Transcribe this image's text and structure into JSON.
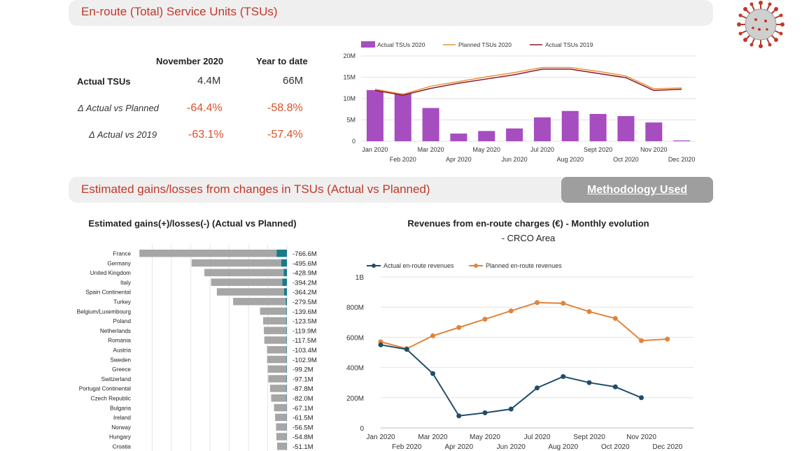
{
  "header1": {
    "title": "En-route (Total) Service Units (TSUs)"
  },
  "header2": {
    "title": "Estimated gains/losses from changes in TSUs (Actual vs Planned)",
    "button": "Methodology Used"
  },
  "kpi": {
    "col1": "November 2020",
    "col2": "Year to date",
    "rows": [
      {
        "label": "Actual TSUs",
        "v1": "4.4M",
        "v2": "66M"
      },
      {
        "label": "Δ Actual vs Planned",
        "v1": "-64.4%",
        "v2": "-58.8%"
      },
      {
        "label": "Δ Actual vs 2019",
        "v1": "-63.1%",
        "v2": "-57.4%"
      }
    ]
  },
  "colors": {
    "purple": "#a64dbf",
    "orange": "#e8943a",
    "darkred": "#8b1a2b",
    "navy": "#1f4e6b",
    "revorange": "#e0843c",
    "gray": "#a6a6a6",
    "teal": "#1a7a8c",
    "red": "#c0392b"
  },
  "chart_data": [
    {
      "type": "bar",
      "title": "",
      "categories": [
        "Jan 2020",
        "Feb 2020",
        "Mar 2020",
        "Apr 2020",
        "May 2020",
        "Jun 2020",
        "Jul 2020",
        "Aug 2020",
        "Sept 2020",
        "Oct 2020",
        "Nov 2020",
        "Dec 2020"
      ],
      "series": [
        {
          "name": "Actual TSUs 2020",
          "values": [
            12.0,
            11.2,
            7.8,
            1.8,
            2.4,
            3.0,
            5.6,
            7.1,
            6.4,
            5.9,
            4.4,
            0.2
          ]
        },
        {
          "name": "Planned TSUs 2020",
          "values": [
            12.2,
            11.0,
            12.9,
            14.0,
            15.1,
            16.1,
            17.3,
            17.3,
            16.4,
            15.3,
            12.3,
            12.5
          ]
        },
        {
          "name": "Actual TSUs 2019",
          "values": [
            11.9,
            10.8,
            12.4,
            13.6,
            14.6,
            15.6,
            16.9,
            16.9,
            15.9,
            14.9,
            11.9,
            12.2
          ]
        }
      ],
      "yticks": [
        "0",
        "5M",
        "10M",
        "15M",
        "20M"
      ],
      "ylim": [
        0,
        20
      ]
    },
    {
      "type": "bar",
      "title": "Estimated gains(+)/losses(-) (Actual vs Planned)",
      "categories": [
        "France",
        "Germany",
        "United Kingdom",
        "Italy",
        "Spain Continental",
        "Turkey",
        "Belgium/Luxembourg",
        "Poland",
        "Netherlands",
        "Romania",
        "Austria",
        "Sweden",
        "Greece",
        "Switzerland",
        "Portugal Continental",
        "Czech Republic",
        "Bulgaria",
        "Ireland",
        "Norway",
        "Hungary",
        "Croatia"
      ],
      "values": [
        -766.6,
        -495.6,
        -428.9,
        -394.2,
        -364.2,
        -279.5,
        -139.6,
        -123.5,
        -119.9,
        -117.5,
        -103.4,
        -102.9,
        -99.2,
        -97.1,
        -87.8,
        -82.0,
        -67.1,
        -61.5,
        -56.5,
        -54.8,
        -51.1
      ],
      "labels": [
        "-766.6M",
        "-495.6M",
        "-428.9M",
        "-394.2M",
        "-364.2M",
        "-279.5M",
        "-139.6M",
        "-123.5M",
        "-119.9M",
        "-117.5M",
        "-103.4M",
        "-102.9M",
        "-99.2M",
        "-97.1M",
        "-87.8M",
        "-82.0M",
        "-67.1M",
        "-61.5M",
        "-56.5M",
        "-54.8M",
        "-51.1M"
      ],
      "teal_share": [
        0.07,
        0.06,
        0.04,
        0.06,
        0.04,
        0.0,
        0.02,
        0.02,
        0.02,
        0.02,
        0.02,
        0.02,
        0.02,
        0.02,
        0.02,
        0.02,
        0.02,
        0.02,
        0.02,
        0.02,
        0.02
      ]
    },
    {
      "type": "line",
      "title": "Revenues from en-route charges (€) - Monthly evolution",
      "subtitle": "- CRCO Area",
      "categories": [
        "Jan 2020",
        "Feb 2020",
        "Mar 2020",
        "Apr 2020",
        "May 2020",
        "Jun 2020",
        "Jul 2020",
        "Aug 2020",
        "Sept 2020",
        "Oct 2020",
        "Nov 2020",
        "Dec 2020"
      ],
      "series": [
        {
          "name": "Actual en-route revenues",
          "values": [
            550,
            520,
            360,
            80,
            100,
            125,
            265,
            340,
            300,
            272,
            200,
            null
          ]
        },
        {
          "name": "Planned en-route revenues",
          "values": [
            570,
            525,
            610,
            665,
            720,
            775,
            830,
            825,
            770,
            725,
            578,
            588
          ]
        }
      ],
      "yticks": [
        "0",
        "200M",
        "400M",
        "600M",
        "800M",
        "1B"
      ],
      "ylim": [
        0,
        1000
      ]
    }
  ]
}
